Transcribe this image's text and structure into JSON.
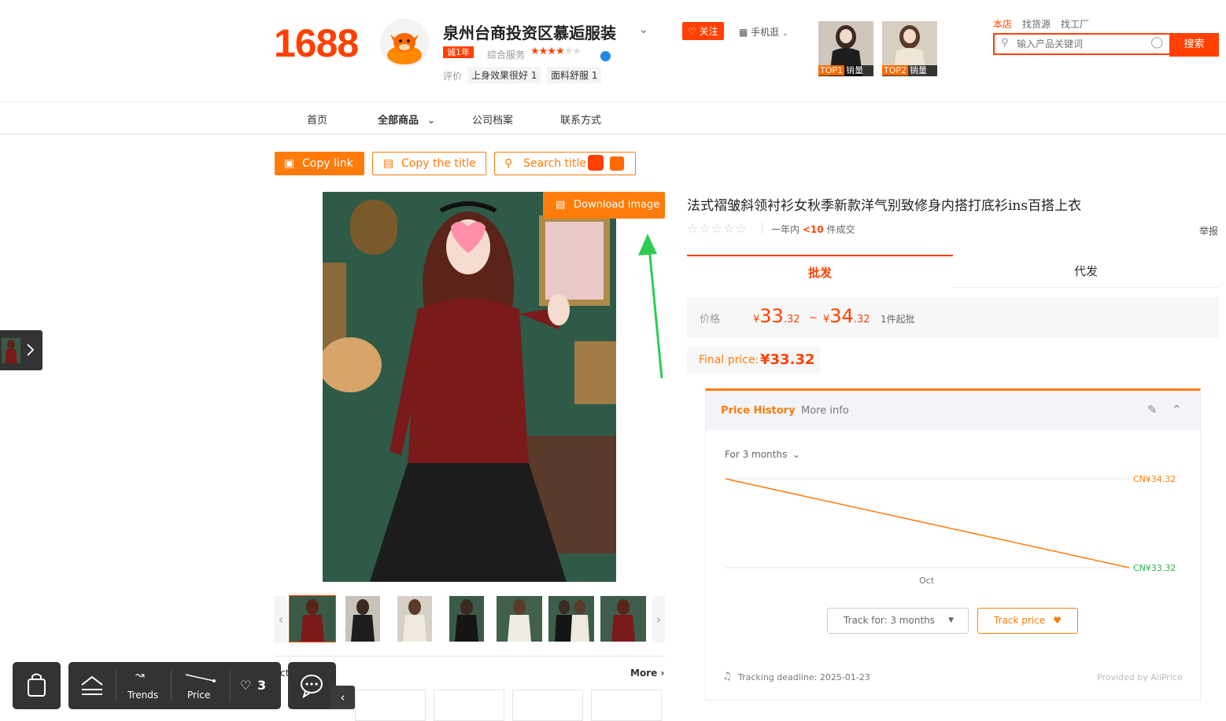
{
  "header": {
    "logo": "1688",
    "shop_name": "泉州台商投资区慕逅服装",
    "year_badge": "诚1年",
    "service_label": "综合服务",
    "rating_label": "评价",
    "tags": [
      "上身效果很好 1",
      "面料舒服 1"
    ],
    "follow_label": "关注",
    "mobile_label": "手机逛",
    "top_products": [
      {
        "rank": "TOP1",
        "label": "销量"
      },
      {
        "rank": "TOP2",
        "label": "销量"
      }
    ],
    "search": {
      "tabs": [
        "本店",
        "找货源",
        "找工厂"
      ],
      "placeholder": "输入产品关键词",
      "button": "搜索"
    }
  },
  "nav": {
    "items": [
      "首页",
      "全部商品",
      "公司档案",
      "联系方式"
    ]
  },
  "actions": {
    "copy_link": "Copy link",
    "copy_title": "Copy the title",
    "search_title": "Search title",
    "download_image": "Download image"
  },
  "gallery": {
    "thumb_count": 7,
    "selected_index": 0,
    "recommend_title": "Similar products",
    "recommend_title_visible": "i                 cts",
    "more": "More"
  },
  "product": {
    "title": "法式褶皱斜领衬衫女秋季新款洋气别致修身内搭打底衫ins百搭上衣",
    "sold_prefix": "一年内",
    "sold_count": "<10",
    "sold_suffix": "件成交",
    "report": "举报",
    "tabs": [
      "批发",
      "代发"
    ],
    "price_label": "价格",
    "price_low": {
      "symbol": "¥",
      "int": "33",
      "dec": ".32"
    },
    "price_high": {
      "symbol": "¥",
      "int": "34",
      "dec": ".32"
    },
    "price_sep": "~",
    "min_order": "1件起批",
    "final_label": "Final price:",
    "final_value": "¥33.32"
  },
  "price_history": {
    "tabs": [
      "Price History",
      "More info"
    ],
    "period": "For 3 months",
    "track_select": "Track for: 3 months",
    "track_button": "Track price",
    "deadline": "Tracking deadline: 2025-01-23",
    "provided_by": "Provided by AliPrice",
    "colors": {
      "line": "#ff7b0a",
      "high": "#ff7b0a",
      "low": "#2cb24f"
    }
  },
  "chart_data": {
    "type": "line",
    "title": "",
    "xlabel": "",
    "ylabel": "",
    "x_ticks": [
      "Oct"
    ],
    "series": [
      {
        "name": "",
        "values": [
          34.32,
          33.32
        ]
      }
    ],
    "y_labels": {
      "high": "CN¥34.32",
      "low": "CN¥33.32"
    },
    "ylim": [
      33.32,
      34.32
    ],
    "grid": true
  },
  "toolbar": {
    "trends": "Trends",
    "price": "Price",
    "favorites_count": "3"
  }
}
